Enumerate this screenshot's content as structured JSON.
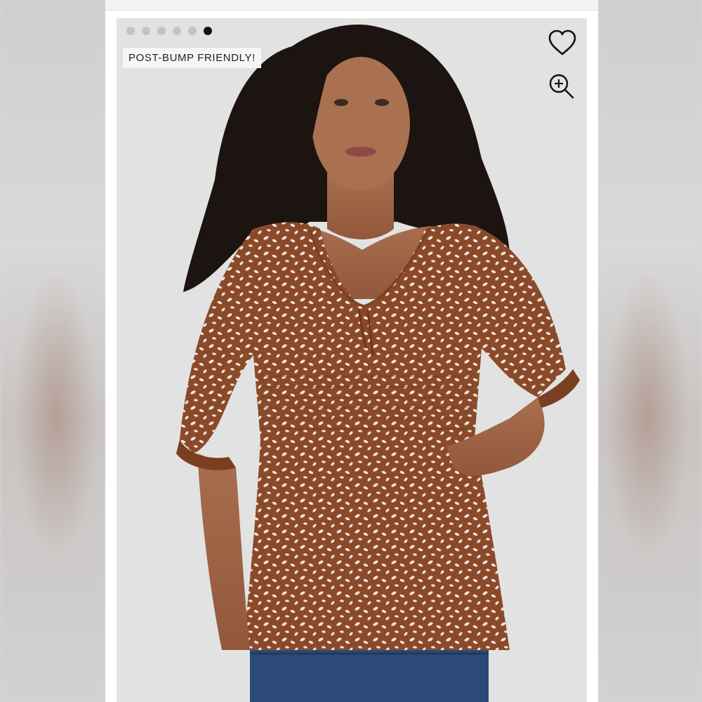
{
  "gallery": {
    "slide_count": 6,
    "active_slide": 6,
    "badge_label": "POST-BUMP FRIENDLY!"
  },
  "icons": {
    "favorite": "heart-outline-icon",
    "zoom": "zoom-in-icon"
  },
  "colors": {
    "badge_bg": "#f6f6f6",
    "dot_inactive": "#c3c3c3",
    "dot_active": "#111111",
    "top_fabric": "#8a4a2a",
    "pattern": "#f2ece6"
  }
}
